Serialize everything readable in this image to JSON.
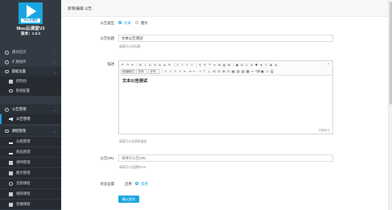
{
  "sidebar": {
    "logo_text": "Muu云课堂",
    "app_name": "Muu云课堂V2",
    "version": "版本：1.0.2",
    "items": [
      {
        "label": "模块首页",
        "icon": "circle-icon"
      },
      {
        "label": "扩展插件",
        "icon": "circle-icon"
      },
      {
        "label": "基础设置",
        "icon": "gear-icon"
      },
      {
        "label": "控制台",
        "icon": "dashboard-icon"
      },
      {
        "label": "系统配置",
        "icon": "gears-icon"
      },
      {
        "label": "公告管理",
        "icon": "circle-icon"
      },
      {
        "label": "公告管理",
        "icon": "megaphone-icon"
      },
      {
        "label": "课程管理",
        "icon": "gear-icon"
      },
      {
        "label": "分类管理",
        "icon": "list-icon"
      },
      {
        "label": "商品管理",
        "icon": "list-icon"
      },
      {
        "label": "讲师管理",
        "icon": "users-icon"
      },
      {
        "label": "图文管理",
        "icon": "document-icon"
      },
      {
        "label": "音频课程",
        "icon": "audio-icon"
      },
      {
        "label": "视频课程",
        "icon": "video-icon"
      },
      {
        "label": "直播课程",
        "icon": "live-icon"
      }
    ]
  },
  "header": {
    "title": "新增/编辑 公告"
  },
  "form": {
    "type_label": "公告类型",
    "type_options": [
      "文本",
      "图片"
    ],
    "title_label": "公告标题",
    "title_value": "文本公告测试",
    "title_help": "请填写公告标题",
    "desc_label": "描述",
    "desc_content": "文本公告测试",
    "word_count": "字数统计",
    "desc_help": "请填写公告简短描述",
    "url_label": "公告URL",
    "url_placeholder": "请填写公告URL",
    "url_help": "请填写公告跳转URL",
    "status_label": "状态设置",
    "status_options": [
      "启用",
      "禁用"
    ],
    "submit_label": "确认提交"
  },
  "editor_toolbar": {
    "row1_glyphs": [
      "↶",
      "↷",
      "✂",
      "B",
      "I",
      "U",
      "S",
      "A",
      "A",
      "✎",
      "≡",
      "≡",
      "≡",
      "≡",
      "¶",
      "¶",
      "❝",
      "∞",
      "⊕",
      "▤",
      "⊞",
      "◉",
      "⊡",
      "☺",
      "Ω",
      "✚",
      "▾",
      "T",
      "≣",
      "⇲"
    ],
    "row2_selects": [
      "段落格式",
      "字体",
      "字号"
    ],
    "row2_glyphs": [
      "≡",
      "≡",
      "≡",
      "≡",
      "⇤",
      "⇥",
      "⊢",
      "⊣",
      "⊤",
      "⊥",
      "⊞",
      "⊟",
      "⊠",
      "⊡",
      "▦",
      "▧",
      "▨",
      "▩",
      "↩",
      "⌫",
      "▣",
      "☐",
      "⎙"
    ]
  }
}
